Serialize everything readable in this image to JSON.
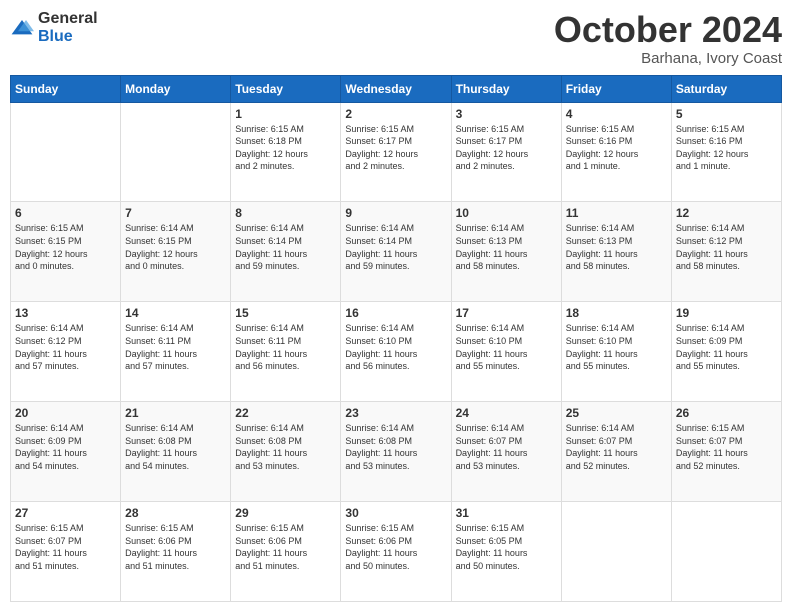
{
  "header": {
    "logo_general": "General",
    "logo_blue": "Blue",
    "month_title": "October 2024",
    "subtitle": "Barhana, Ivory Coast"
  },
  "days_of_week": [
    "Sunday",
    "Monday",
    "Tuesday",
    "Wednesday",
    "Thursday",
    "Friday",
    "Saturday"
  ],
  "weeks": [
    [
      {
        "day": "",
        "info": ""
      },
      {
        "day": "",
        "info": ""
      },
      {
        "day": "1",
        "info": "Sunrise: 6:15 AM\nSunset: 6:18 PM\nDaylight: 12 hours\nand 2 minutes."
      },
      {
        "day": "2",
        "info": "Sunrise: 6:15 AM\nSunset: 6:17 PM\nDaylight: 12 hours\nand 2 minutes."
      },
      {
        "day": "3",
        "info": "Sunrise: 6:15 AM\nSunset: 6:17 PM\nDaylight: 12 hours\nand 2 minutes."
      },
      {
        "day": "4",
        "info": "Sunrise: 6:15 AM\nSunset: 6:16 PM\nDaylight: 12 hours\nand 1 minute."
      },
      {
        "day": "5",
        "info": "Sunrise: 6:15 AM\nSunset: 6:16 PM\nDaylight: 12 hours\nand 1 minute."
      }
    ],
    [
      {
        "day": "6",
        "info": "Sunrise: 6:15 AM\nSunset: 6:15 PM\nDaylight: 12 hours\nand 0 minutes."
      },
      {
        "day": "7",
        "info": "Sunrise: 6:14 AM\nSunset: 6:15 PM\nDaylight: 12 hours\nand 0 minutes."
      },
      {
        "day": "8",
        "info": "Sunrise: 6:14 AM\nSunset: 6:14 PM\nDaylight: 11 hours\nand 59 minutes."
      },
      {
        "day": "9",
        "info": "Sunrise: 6:14 AM\nSunset: 6:14 PM\nDaylight: 11 hours\nand 59 minutes."
      },
      {
        "day": "10",
        "info": "Sunrise: 6:14 AM\nSunset: 6:13 PM\nDaylight: 11 hours\nand 58 minutes."
      },
      {
        "day": "11",
        "info": "Sunrise: 6:14 AM\nSunset: 6:13 PM\nDaylight: 11 hours\nand 58 minutes."
      },
      {
        "day": "12",
        "info": "Sunrise: 6:14 AM\nSunset: 6:12 PM\nDaylight: 11 hours\nand 58 minutes."
      }
    ],
    [
      {
        "day": "13",
        "info": "Sunrise: 6:14 AM\nSunset: 6:12 PM\nDaylight: 11 hours\nand 57 minutes."
      },
      {
        "day": "14",
        "info": "Sunrise: 6:14 AM\nSunset: 6:11 PM\nDaylight: 11 hours\nand 57 minutes."
      },
      {
        "day": "15",
        "info": "Sunrise: 6:14 AM\nSunset: 6:11 PM\nDaylight: 11 hours\nand 56 minutes."
      },
      {
        "day": "16",
        "info": "Sunrise: 6:14 AM\nSunset: 6:10 PM\nDaylight: 11 hours\nand 56 minutes."
      },
      {
        "day": "17",
        "info": "Sunrise: 6:14 AM\nSunset: 6:10 PM\nDaylight: 11 hours\nand 55 minutes."
      },
      {
        "day": "18",
        "info": "Sunrise: 6:14 AM\nSunset: 6:10 PM\nDaylight: 11 hours\nand 55 minutes."
      },
      {
        "day": "19",
        "info": "Sunrise: 6:14 AM\nSunset: 6:09 PM\nDaylight: 11 hours\nand 55 minutes."
      }
    ],
    [
      {
        "day": "20",
        "info": "Sunrise: 6:14 AM\nSunset: 6:09 PM\nDaylight: 11 hours\nand 54 minutes."
      },
      {
        "day": "21",
        "info": "Sunrise: 6:14 AM\nSunset: 6:08 PM\nDaylight: 11 hours\nand 54 minutes."
      },
      {
        "day": "22",
        "info": "Sunrise: 6:14 AM\nSunset: 6:08 PM\nDaylight: 11 hours\nand 53 minutes."
      },
      {
        "day": "23",
        "info": "Sunrise: 6:14 AM\nSunset: 6:08 PM\nDaylight: 11 hours\nand 53 minutes."
      },
      {
        "day": "24",
        "info": "Sunrise: 6:14 AM\nSunset: 6:07 PM\nDaylight: 11 hours\nand 53 minutes."
      },
      {
        "day": "25",
        "info": "Sunrise: 6:14 AM\nSunset: 6:07 PM\nDaylight: 11 hours\nand 52 minutes."
      },
      {
        "day": "26",
        "info": "Sunrise: 6:15 AM\nSunset: 6:07 PM\nDaylight: 11 hours\nand 52 minutes."
      }
    ],
    [
      {
        "day": "27",
        "info": "Sunrise: 6:15 AM\nSunset: 6:07 PM\nDaylight: 11 hours\nand 51 minutes."
      },
      {
        "day": "28",
        "info": "Sunrise: 6:15 AM\nSunset: 6:06 PM\nDaylight: 11 hours\nand 51 minutes."
      },
      {
        "day": "29",
        "info": "Sunrise: 6:15 AM\nSunset: 6:06 PM\nDaylight: 11 hours\nand 51 minutes."
      },
      {
        "day": "30",
        "info": "Sunrise: 6:15 AM\nSunset: 6:06 PM\nDaylight: 11 hours\nand 50 minutes."
      },
      {
        "day": "31",
        "info": "Sunrise: 6:15 AM\nSunset: 6:05 PM\nDaylight: 11 hours\nand 50 minutes."
      },
      {
        "day": "",
        "info": ""
      },
      {
        "day": "",
        "info": ""
      }
    ]
  ]
}
